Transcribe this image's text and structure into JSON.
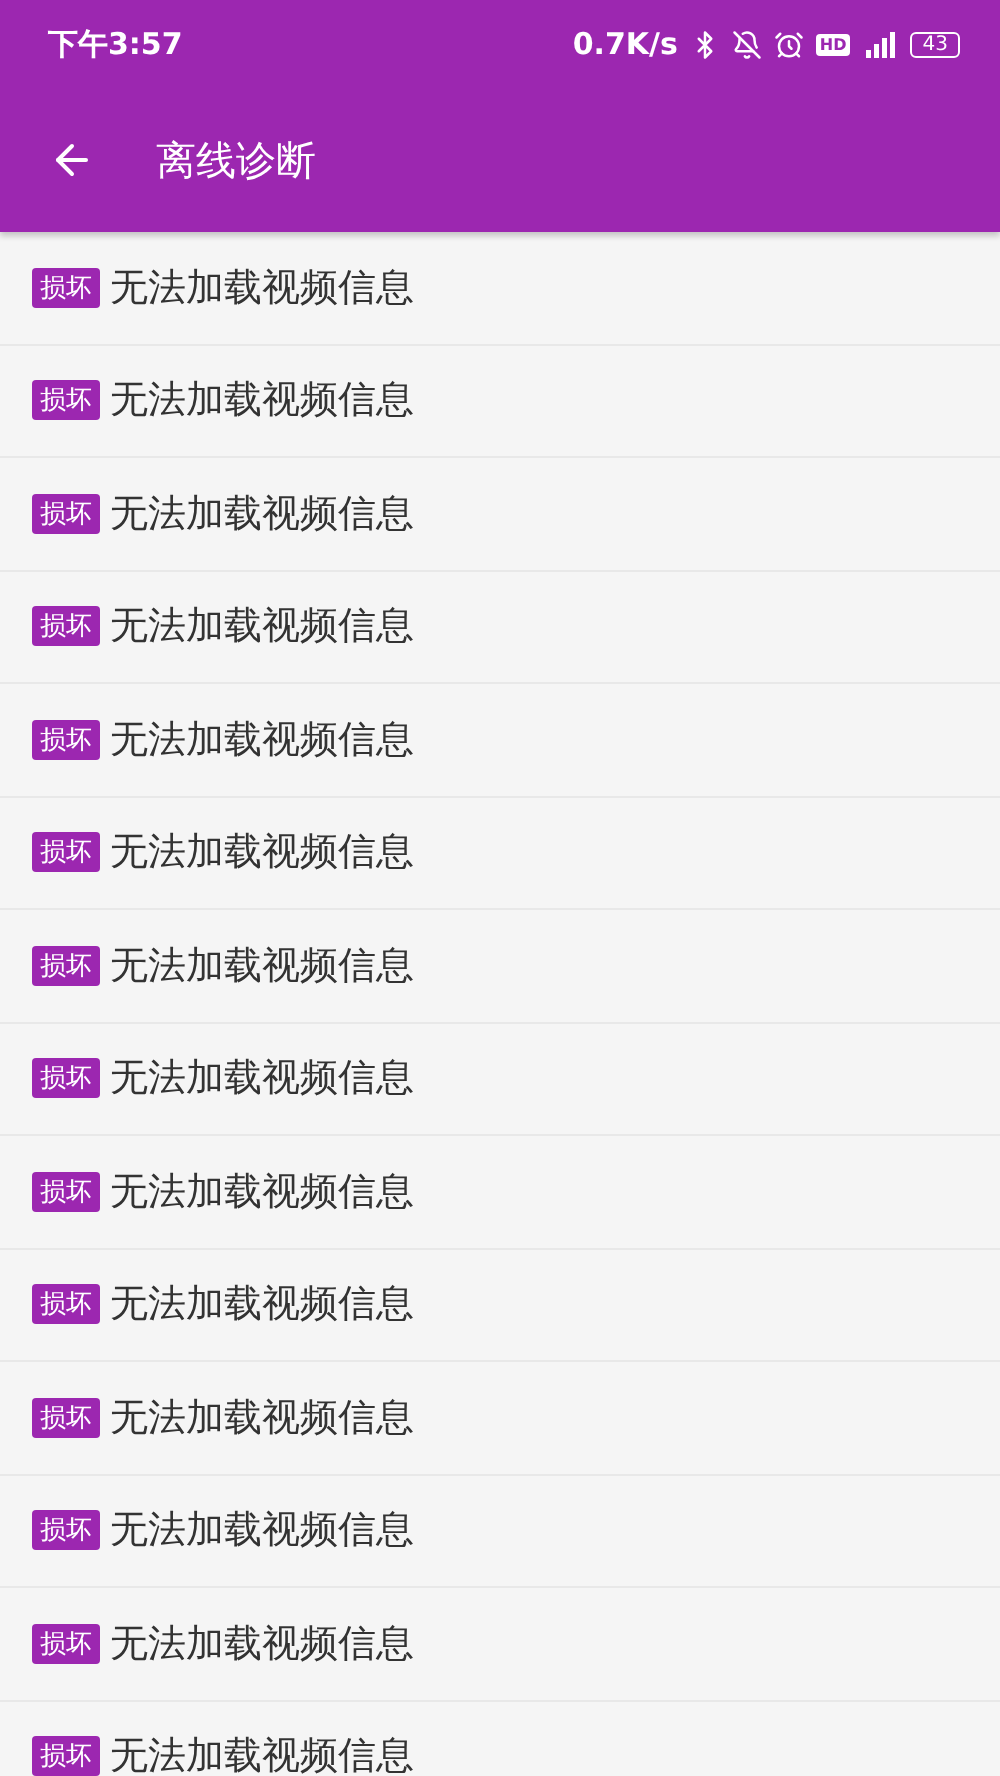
{
  "status_bar": {
    "time": "下午3:57",
    "speed": "0.7K/s",
    "hd": "HD",
    "battery": "43"
  },
  "toolbar": {
    "title": "离线诊断"
  },
  "items": [
    {
      "tag": "损坏",
      "text": "无法加载视频信息"
    },
    {
      "tag": "损坏",
      "text": "无法加载视频信息"
    },
    {
      "tag": "损坏",
      "text": "无法加载视频信息"
    },
    {
      "tag": "损坏",
      "text": "无法加载视频信息"
    },
    {
      "tag": "损坏",
      "text": "无法加载视频信息"
    },
    {
      "tag": "损坏",
      "text": "无法加载视频信息"
    },
    {
      "tag": "损坏",
      "text": "无法加载视频信息"
    },
    {
      "tag": "损坏",
      "text": "无法加载视频信息"
    },
    {
      "tag": "损坏",
      "text": "无法加载视频信息"
    },
    {
      "tag": "损坏",
      "text": "无法加载视频信息"
    },
    {
      "tag": "损坏",
      "text": "无法加载视频信息"
    },
    {
      "tag": "损坏",
      "text": "无法加载视频信息"
    },
    {
      "tag": "损坏",
      "text": "无法加载视频信息"
    },
    {
      "tag": "损坏",
      "text": "无法加载视频信息"
    }
  ]
}
